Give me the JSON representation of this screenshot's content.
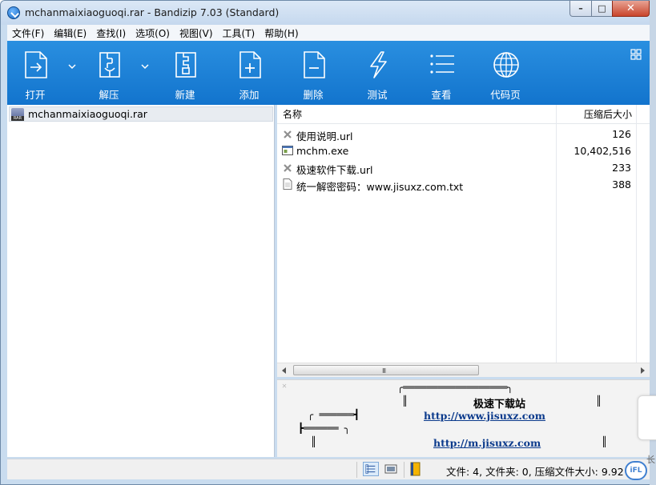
{
  "window": {
    "title": "mchanmaixiaoguoqi.rar - Bandizip 7.03 (Standard)",
    "min_glyph": "–",
    "max_glyph": "□",
    "close_glyph": "✕"
  },
  "menu": [
    {
      "label": "文件(F)"
    },
    {
      "label": "编辑(E)"
    },
    {
      "label": "查找(I)"
    },
    {
      "label": "选项(O)"
    },
    {
      "label": "视图(V)"
    },
    {
      "label": "工具(T)"
    },
    {
      "label": "帮助(H)"
    }
  ],
  "toolbar": {
    "buttons": [
      {
        "label": "打开",
        "icon": "open-icon"
      },
      {
        "label": "解压",
        "icon": "extract-icon"
      },
      {
        "label": "新建",
        "icon": "new-archive-icon"
      },
      {
        "label": "添加",
        "icon": "add-icon"
      },
      {
        "label": "删除",
        "icon": "delete-icon"
      },
      {
        "label": "测试",
        "icon": "test-icon"
      },
      {
        "label": "查看",
        "icon": "view-icon"
      },
      {
        "label": "代码页",
        "icon": "codepage-icon"
      }
    ],
    "accent": "#1a7fd6"
  },
  "tree": {
    "root": "mchanmaixiaoguoqi.rar",
    "root_badge": "RAR"
  },
  "filelist": {
    "columns": {
      "name": "名称",
      "size": "压缩后大小"
    },
    "rows": [
      {
        "name": "使用说明.url",
        "size": "126",
        "icon": "url-file-icon"
      },
      {
        "name": "mchm.exe",
        "size": "10,402,516",
        "icon": "exe-file-icon"
      },
      {
        "name": "极速软件下载.url",
        "size": "233",
        "icon": "url-file-icon"
      },
      {
        "name": "统一解密密码：www.jisuxz.com.txt",
        "size": "388",
        "icon": "txt-file-icon"
      }
    ],
    "scroll_grip": "III"
  },
  "preview": {
    "title": "极速下载站",
    "link1": "http://www.jisuxz.com",
    "link2": "http://m.jisuxz.com",
    "ascii_top": "╭══════════════════╮",
    "ascii_bar_left": "║",
    "ascii_bar_right": "║",
    "ascii_mid1": "╭ ══════┫",
    "ascii_mid2": "┣══════ ╮",
    "close_glyph": "✕"
  },
  "statusbar": {
    "text": "文件: 4, 文件夹: 0, 压缩文件大小: 9.92 M"
  },
  "widgets": {
    "side_text": "长",
    "badge": "iFL"
  }
}
